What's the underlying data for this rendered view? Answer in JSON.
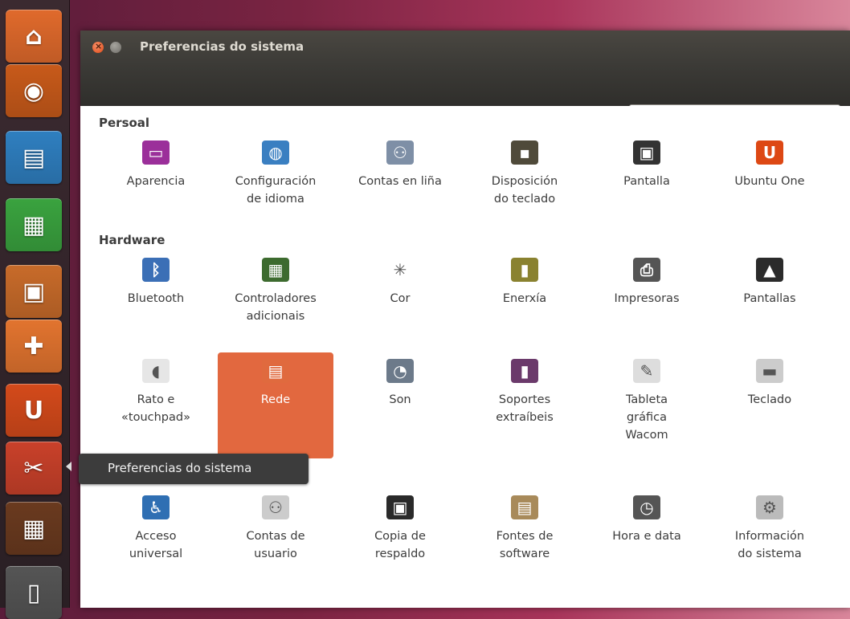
{
  "window": {
    "title": "Preferencias do sistema",
    "search_placeholder": ""
  },
  "tooltip": {
    "text": "Preferencias do sistema"
  },
  "launcher": {
    "items": [
      {
        "name": "home-folder",
        "icon": "home-icon",
        "color": "#e06a2c",
        "glyph": "⌂"
      },
      {
        "name": "firefox",
        "icon": "firefox-icon",
        "color": "#c85a1a",
        "glyph": "◉"
      },
      {
        "name": "libreoffice-writer",
        "icon": "writer-icon",
        "color": "#2f7fc0",
        "glyph": "▤"
      },
      {
        "name": "libreoffice-calc",
        "icon": "calc-icon",
        "color": "#3aa33f",
        "glyph": "▦"
      },
      {
        "name": "libreoffice-impress",
        "icon": "impress-icon",
        "color": "#c86b2a",
        "glyph": "▣"
      },
      {
        "name": "ubuntu-software-center",
        "icon": "software-center-icon",
        "color": "#e2742f",
        "glyph": "✚"
      },
      {
        "name": "ubuntu-one",
        "icon": "ubuntu-one-icon",
        "color": "#d44a1b",
        "glyph": "U"
      },
      {
        "name": "system-settings",
        "icon": "settings-icon",
        "color": "#c9412a",
        "glyph": "✂"
      },
      {
        "name": "workspaces",
        "icon": "workspace-icon",
        "color": "#6a3a1f",
        "glyph": "▦"
      },
      {
        "name": "trash",
        "icon": "trash-icon",
        "color": "#555555",
        "glyph": "▯"
      }
    ]
  },
  "sections": {
    "personal": "Persoal",
    "hardware": "Hardware"
  },
  "personal_items": [
    {
      "label": "Aparencia",
      "icon": "appearance-icon",
      "color": "#9b2f9a",
      "glyph": "▭"
    },
    {
      "label": "Configuración\nde idioma",
      "icon": "language-icon",
      "color": "#3a7fc1",
      "glyph": "◍"
    },
    {
      "label": "Contas en liña",
      "icon": "online-accounts-icon",
      "color": "#7e8fa6",
      "glyph": "⚇"
    },
    {
      "label": "Disposición\ndo teclado",
      "icon": "keyboard-layout-icon",
      "color": "#4f4a3a",
      "glyph": "▪"
    },
    {
      "label": "Pantalla",
      "icon": "lock-screen-icon",
      "color": "#333333",
      "glyph": "▣"
    },
    {
      "label": "Ubuntu One",
      "icon": "ubuntu-one-icon",
      "color": "#dd4814",
      "glyph": "U"
    }
  ],
  "hardware_items": [
    {
      "label": "Bluetooth",
      "icon": "bluetooth-icon",
      "color": "#3b6fb6",
      "glyph": "ᛒ"
    },
    {
      "label": "Controladores\nadicionais",
      "icon": "drivers-icon",
      "color": "#3d6b2f",
      "glyph": "▦"
    },
    {
      "label": "Cor",
      "icon": "color-icon",
      "color": "#ffffff",
      "glyph": "✳"
    },
    {
      "label": "Enerxía",
      "icon": "power-icon",
      "color": "#8a8230",
      "glyph": "▮"
    },
    {
      "label": "Impresoras",
      "icon": "printer-icon",
      "color": "#555555",
      "glyph": "⎙"
    },
    {
      "label": "Pantallas",
      "icon": "displays-icon",
      "color": "#2b2b2b",
      "glyph": "▲"
    },
    {
      "label": "Rato e\n«touchpad»",
      "icon": "mouse-icon",
      "color": "#e6e6e6",
      "glyph": "◖"
    },
    {
      "label": "Rede",
      "icon": "network-icon",
      "color": "#e06a3e",
      "glyph": "▤"
    },
    {
      "label": "Son",
      "icon": "sound-icon",
      "color": "#6c7a8a",
      "glyph": "◔"
    },
    {
      "label": "Soportes\nextraíbeis",
      "icon": "removable-media-icon",
      "color": "#6b3a6b",
      "glyph": "▮"
    },
    {
      "label": "Tableta\ngráfica\nWacom",
      "icon": "wacom-tablet-icon",
      "color": "#dddddd",
      "glyph": "✎"
    },
    {
      "label": "Teclado",
      "icon": "keyboard-icon",
      "color": "#cccccc",
      "glyph": "▬"
    }
  ],
  "system_items": [
    {
      "label": "Acceso\nuniversal",
      "icon": "universal-access-icon",
      "color": "#2f6fb3",
      "glyph": "♿"
    },
    {
      "label": "Contas de\nusuario",
      "icon": "user-accounts-icon",
      "color": "#cccccc",
      "glyph": "⚇"
    },
    {
      "label": "Copia de\nrespaldo",
      "icon": "backup-icon",
      "color": "#2a2a2a",
      "glyph": "▣"
    },
    {
      "label": "Fontes de\nsoftware",
      "icon": "software-sources-icon",
      "color": "#a88a5a",
      "glyph": "▤"
    },
    {
      "label": "Hora e data",
      "icon": "clock-icon",
      "color": "#555555",
      "glyph": "◷"
    },
    {
      "label": "Información\ndo sistema",
      "icon": "system-info-icon",
      "color": "#bbbbbb",
      "glyph": "⚙"
    }
  ]
}
